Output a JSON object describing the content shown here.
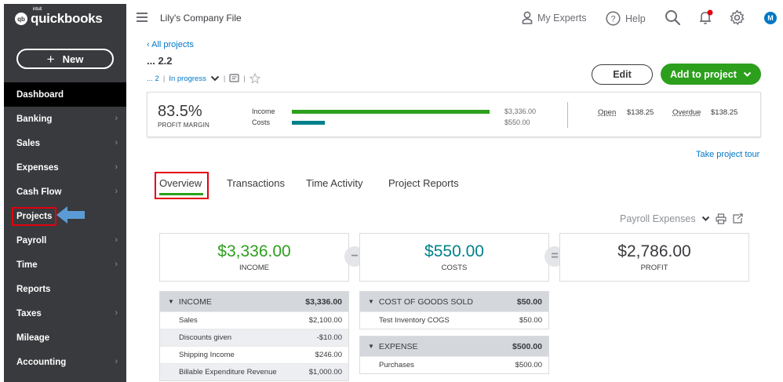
{
  "app": {
    "logo_sup": "intuit",
    "logo_name": "quickbooks",
    "logo_badge": "qb"
  },
  "sidebar": {
    "new_label": "New",
    "items": [
      {
        "label": "Dashboard",
        "chevron": false
      },
      {
        "label": "Banking",
        "chevron": true
      },
      {
        "label": "Sales",
        "chevron": true
      },
      {
        "label": "Expenses",
        "chevron": true
      },
      {
        "label": "Cash Flow",
        "chevron": true
      },
      {
        "label": "Projects",
        "chevron": false
      },
      {
        "label": "Payroll",
        "chevron": true
      },
      {
        "label": "Time",
        "chevron": true
      },
      {
        "label": "Reports",
        "chevron": false
      },
      {
        "label": "Taxes",
        "chevron": true
      },
      {
        "label": "Mileage",
        "chevron": false
      },
      {
        "label": "Accounting",
        "chevron": true
      }
    ]
  },
  "topbar": {
    "company": "Lily's Company File",
    "my_experts": "My Experts",
    "help": "Help",
    "avatar_initial": "M"
  },
  "project": {
    "back_link": "All projects",
    "title": "... 2.2",
    "parent": "... 2",
    "status": "In progress"
  },
  "actions": {
    "edit": "Edit",
    "add_to_project": "Add to project"
  },
  "summary": {
    "profit_margin": "83.5%",
    "profit_margin_label": "PROFIT MARGIN",
    "income_label": "Income",
    "costs_label": "Costs",
    "income_amount": "$3,336.00",
    "costs_amount": "$550.00",
    "income_fraction": 1.0,
    "costs_fraction": 0.165,
    "open_label": "Open",
    "open_amount": "$138.25",
    "overdue_label": "Overdue",
    "overdue_amount": "$138.25"
  },
  "tour_link": "Take project tour",
  "tabs": [
    "Overview",
    "Transactions",
    "Time Activity",
    "Project Reports"
  ],
  "filter": {
    "selected": "Payroll Expenses"
  },
  "totals": {
    "income_amount": "$3,336.00",
    "income_label": "INCOME",
    "costs_amount": "$550.00",
    "costs_label": "COSTS",
    "profit_amount": "$2,786.00",
    "profit_label": "PROFIT",
    "minus": "−",
    "equals": "="
  },
  "income_table": {
    "header": "INCOME",
    "total": "$3,336.00",
    "rows": [
      {
        "name": "Sales",
        "amount": "$2,100.00"
      },
      {
        "name": "Discounts given",
        "amount": "-$10.00"
      },
      {
        "name": "Shipping Income",
        "amount": "$246.00"
      },
      {
        "name": "Billable Expenditure Revenue",
        "amount": "$1,000.00"
      }
    ]
  },
  "cogs_table": {
    "header": "COST OF GOODS SOLD",
    "total": "$50.00",
    "rows": [
      {
        "name": "Test Inventory COGS",
        "amount": "$50.00"
      }
    ]
  },
  "expense_table": {
    "header": "EXPENSE",
    "total": "$500.00",
    "rows": [
      {
        "name": "Purchases",
        "amount": "$500.00"
      }
    ]
  },
  "colors": {
    "sidebar_bg": "#393a3d",
    "brand_green": "#2ca01c",
    "teal": "#00818a",
    "link_blue": "#0077c5",
    "highlight_red": "#e3000f",
    "arrow_blue": "#5b9bd5"
  }
}
